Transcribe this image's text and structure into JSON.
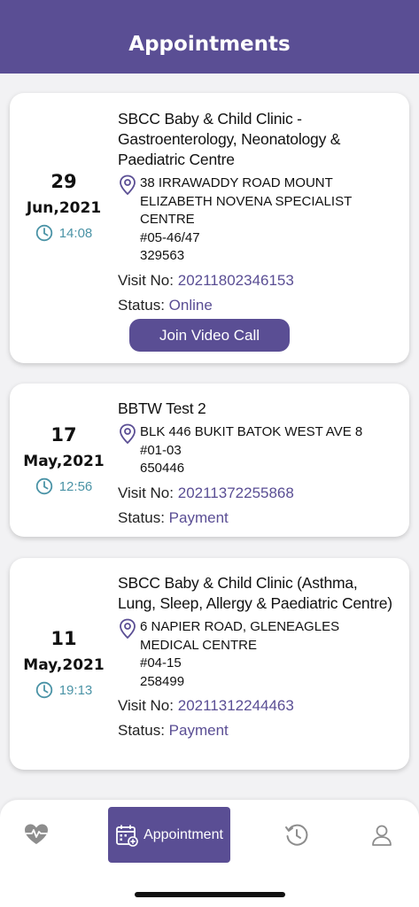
{
  "header": {
    "title": "Appointments"
  },
  "appointments": [
    {
      "day": "29",
      "month_year": "Jun,2021",
      "time": "14:08",
      "clinic": "SBCC Baby & Child Clinic - Gastroenterology, Neonatology & Paediatric Centre",
      "address_lines": [
        "38 IRRAWADDY ROAD MOUNT",
        "ELIZABETH NOVENA SPECIALIST",
        "CENTRE",
        "#05-46/47",
        "329563"
      ],
      "visit_label": "Visit No:",
      "visit_no": "20211802346153",
      "status_label": "Status:",
      "status": "Online",
      "action_label": "Join Video Call"
    },
    {
      "day": "17",
      "month_year": "May,2021",
      "time": "12:56",
      "clinic": "BBTW Test 2",
      "address_lines": [
        "BLK 446 BUKIT BATOK WEST AVE 8",
        "#01-03",
        "650446"
      ],
      "visit_label": "Visit No:",
      "visit_no": "20211372255868",
      "status_label": "Status:",
      "status": "Payment"
    },
    {
      "day": "11",
      "month_year": "May,2021",
      "time": "19:13",
      "clinic": "SBCC Baby & Child Clinic (Asthma, Lung, Sleep, Allergy & Paediatric Centre)",
      "address_lines": [
        "6 NAPIER ROAD, GLENEAGLES",
        "MEDICAL CENTRE",
        "#04-15",
        "258499"
      ],
      "visit_label": "Visit No:",
      "visit_no": "20211312244463",
      "status_label": "Status:",
      "status": "Payment"
    }
  ],
  "bottom_nav": {
    "items": [
      {
        "icon": "heartbeat-icon"
      },
      {
        "icon": "calendar-icon",
        "label": "Appointment",
        "active": true
      },
      {
        "icon": "history-icon"
      },
      {
        "icon": "profile-icon"
      }
    ]
  },
  "colors": {
    "primary": "#5a4e94",
    "time_accent": "#4a93a6",
    "background": "#f2f2f4"
  }
}
